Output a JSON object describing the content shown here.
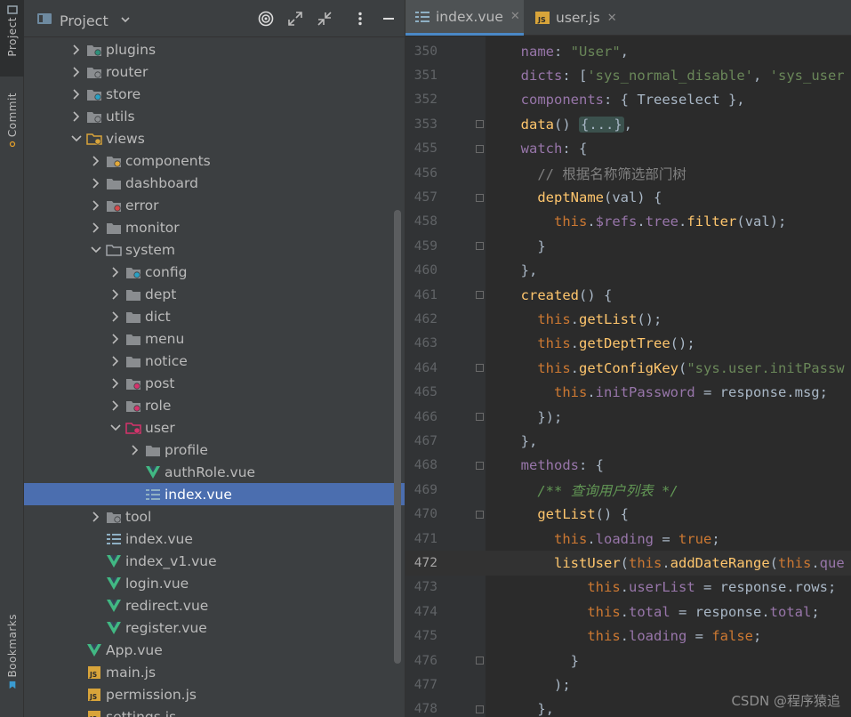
{
  "strip": {
    "project_label": "Project",
    "commit_label": "Commit",
    "bookmarks_label": "Bookmarks"
  },
  "panel": {
    "title": "Project"
  },
  "tree": [
    {
      "label": "plugins",
      "depth": 1,
      "icon": "folder-plugin-icon",
      "expandable": true,
      "expanded": false
    },
    {
      "label": "router",
      "depth": 1,
      "icon": "folder-router-icon",
      "expandable": true,
      "expanded": false
    },
    {
      "label": "store",
      "depth": 1,
      "icon": "folder-store-icon",
      "expandable": true,
      "expanded": false
    },
    {
      "label": "utils",
      "depth": 1,
      "icon": "folder-utils-icon",
      "expandable": true,
      "expanded": false
    },
    {
      "label": "views",
      "depth": 1,
      "icon": "folder-views-icon",
      "expandable": true,
      "expanded": true
    },
    {
      "label": "components",
      "depth": 2,
      "icon": "folder-components-icon",
      "expandable": true,
      "expanded": false
    },
    {
      "label": "dashboard",
      "depth": 2,
      "icon": "folder-icon",
      "expandable": true,
      "expanded": false
    },
    {
      "label": "error",
      "depth": 2,
      "icon": "folder-error-icon",
      "expandable": true,
      "expanded": false
    },
    {
      "label": "monitor",
      "depth": 2,
      "icon": "folder-icon",
      "expandable": true,
      "expanded": false
    },
    {
      "label": "system",
      "depth": 2,
      "icon": "folder-open-icon",
      "expandable": true,
      "expanded": true
    },
    {
      "label": "config",
      "depth": 3,
      "icon": "folder-config-icon",
      "expandable": true,
      "expanded": false
    },
    {
      "label": "dept",
      "depth": 3,
      "icon": "folder-icon",
      "expandable": true,
      "expanded": false
    },
    {
      "label": "dict",
      "depth": 3,
      "icon": "folder-icon",
      "expandable": true,
      "expanded": false
    },
    {
      "label": "menu",
      "depth": 3,
      "icon": "folder-icon",
      "expandable": true,
      "expanded": false
    },
    {
      "label": "notice",
      "depth": 3,
      "icon": "folder-icon",
      "expandable": true,
      "expanded": false
    },
    {
      "label": "post",
      "depth": 3,
      "icon": "folder-post-icon",
      "expandable": true,
      "expanded": false
    },
    {
      "label": "role",
      "depth": 3,
      "icon": "folder-role-icon",
      "expandable": true,
      "expanded": false
    },
    {
      "label": "user",
      "depth": 3,
      "icon": "folder-user-icon",
      "expandable": true,
      "expanded": true
    },
    {
      "label": "profile",
      "depth": 4,
      "icon": "folder-icon",
      "expandable": true,
      "expanded": false
    },
    {
      "label": "authRole.vue",
      "depth": 4,
      "icon": "vue-file-icon",
      "expandable": false
    },
    {
      "label": "index.vue",
      "depth": 4,
      "icon": "vue-index-file-icon",
      "expandable": false,
      "selected": true
    },
    {
      "label": "tool",
      "depth": 2,
      "icon": "folder-tool-icon",
      "expandable": true,
      "expanded": false
    },
    {
      "label": "index.vue",
      "depth": 2,
      "icon": "vue-index-file-icon",
      "expandable": false
    },
    {
      "label": "index_v1.vue",
      "depth": 2,
      "icon": "vue-file-icon",
      "expandable": false
    },
    {
      "label": "login.vue",
      "depth": 2,
      "icon": "vue-file-icon",
      "expandable": false
    },
    {
      "label": "redirect.vue",
      "depth": 2,
      "icon": "vue-file-icon",
      "expandable": false
    },
    {
      "label": "register.vue",
      "depth": 2,
      "icon": "vue-file-icon",
      "expandable": false
    },
    {
      "label": "App.vue",
      "depth": 1,
      "icon": "vue-file-icon",
      "expandable": false
    },
    {
      "label": "main.js",
      "depth": 1,
      "icon": "js-file-icon",
      "expandable": false
    },
    {
      "label": "permission.js",
      "depth": 1,
      "icon": "js-file-icon",
      "expandable": false
    },
    {
      "label": "settings.js",
      "depth": 1,
      "icon": "js-file-icon",
      "expandable": false
    }
  ],
  "tabs": [
    {
      "label": "index.vue",
      "icon": "vue-index-file-icon",
      "active": true,
      "close": "✕"
    },
    {
      "label": "user.js",
      "icon": "js-file-icon",
      "active": false,
      "close": "✕"
    }
  ],
  "editor": {
    "current_line": 472,
    "lines": [
      {
        "n": 350,
        "text": "  name: \"User\","
      },
      {
        "n": 351,
        "text": "  dicts: ['sys_normal_disable', 'sys_user"
      },
      {
        "n": 352,
        "text": "  components: { Treeselect },"
      },
      {
        "n": 353,
        "text": "  data() {...},"
      },
      {
        "n": 455,
        "text": "  watch: {"
      },
      {
        "n": 456,
        "text": "    // 根据名称筛选部门树"
      },
      {
        "n": 457,
        "text": "    deptName(val) {"
      },
      {
        "n": 458,
        "text": "      this.$refs.tree.filter(val);"
      },
      {
        "n": 459,
        "text": "    }"
      },
      {
        "n": 460,
        "text": "  },"
      },
      {
        "n": 461,
        "text": "  created() {"
      },
      {
        "n": 462,
        "text": "    this.getList();"
      },
      {
        "n": 463,
        "text": "    this.getDeptTree();"
      },
      {
        "n": 464,
        "text": "    this.getConfigKey(\"sys.user.initPassw"
      },
      {
        "n": 465,
        "text": "      this.initPassword = response.msg;"
      },
      {
        "n": 466,
        "text": "    });"
      },
      {
        "n": 467,
        "text": "  },"
      },
      {
        "n": 468,
        "text": "  methods: {"
      },
      {
        "n": 469,
        "text": "    /** 查询用户列表 */"
      },
      {
        "n": 470,
        "text": "    getList() {"
      },
      {
        "n": 471,
        "text": "      this.loading = true;"
      },
      {
        "n": 472,
        "text": "      listUser(this.addDateRange(this.que"
      },
      {
        "n": 473,
        "text": "          this.userList = response.rows;"
      },
      {
        "n": 474,
        "text": "          this.total = response.total;"
      },
      {
        "n": 475,
        "text": "          this.loading = false;"
      },
      {
        "n": 476,
        "text": "        }"
      },
      {
        "n": 477,
        "text": "      );"
      },
      {
        "n": 478,
        "text": "    },"
      }
    ]
  },
  "watermark": "CSDN @程序猿追"
}
